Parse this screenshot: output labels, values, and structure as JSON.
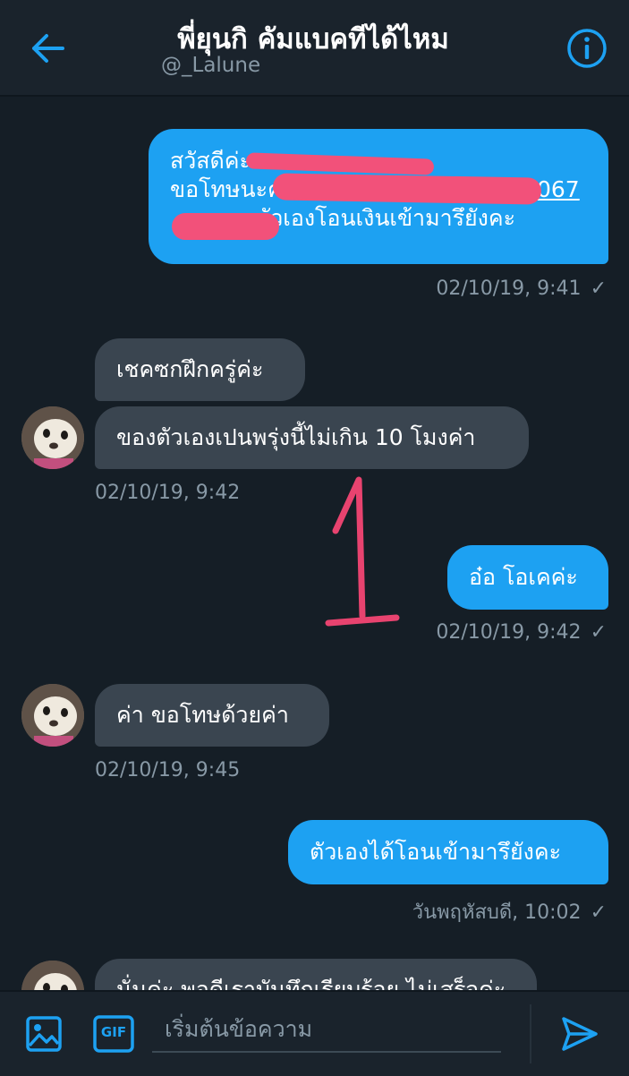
{
  "header": {
    "title": "พี่ยุนกิ คัมแบคทีได้ไหม",
    "handle": "@_Lalune"
  },
  "messages": [
    {
      "direction": "out",
      "lines": [
        "สวัสดีค่ะ",
        "ขอโทษนะคะ",
        "ตัวเองโอนเงินเข้ามารึยังคะ"
      ],
      "visible_fragments": [
        "067"
      ],
      "timestamp": "02/10/19, 9:41",
      "status": "✓",
      "redacted": true
    },
    {
      "direction": "in",
      "text": "เชคซกฝึกครู่ค่ะ"
    },
    {
      "direction": "in",
      "text": "ของตัวเองเปนพรุ่งนี้ไม่เกิน 10 โมงค่า",
      "timestamp": "02/10/19, 9:42"
    },
    {
      "direction": "out",
      "text": "อ๋อ โอเคค่ะ",
      "timestamp": "02/10/19, 9:42",
      "status": "✓"
    },
    {
      "direction": "in",
      "text": "ค่า ขอโทษด้วยค่า",
      "timestamp": "02/10/19, 9:45"
    },
    {
      "direction": "out",
      "text": "ตัวเองได้โอนเข้ามารึยังคะ",
      "timestamp": "วันพฤหัสบดี, 10:02",
      "status": "✓"
    },
    {
      "direction": "in",
      "text": "นั่นค่ะ พอดีเราบันทึกเรียบร้อย ไม่เสร็จค่ะ",
      "partial": true
    }
  ],
  "annotation": {
    "text": "1",
    "color": "#e8436f"
  },
  "composer": {
    "placeholder": "เริ่มต้นข้อความ",
    "gif_label": "GIF"
  },
  "colors": {
    "accent": "#1da1f2",
    "background": "#151e26",
    "incoming_bubble": "#3a4550",
    "muted_text": "#8899a6",
    "redaction": "#f2517a"
  },
  "icons": [
    "back-arrow-icon",
    "info-icon",
    "image-icon",
    "gif-icon",
    "send-icon"
  ]
}
